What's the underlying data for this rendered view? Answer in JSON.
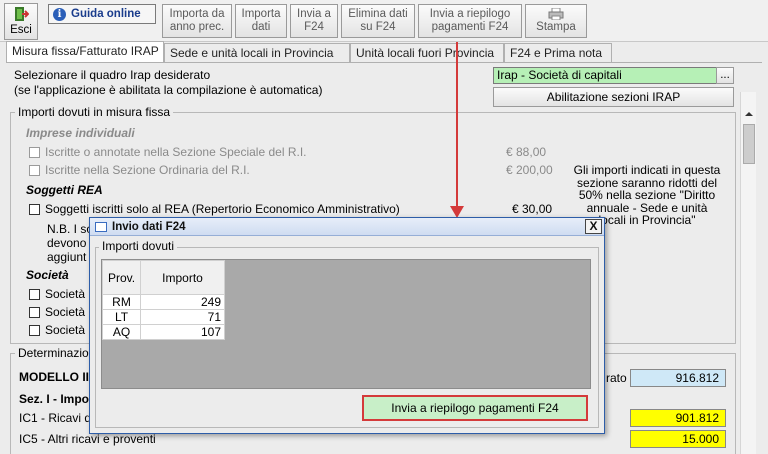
{
  "toolbar": {
    "esci": "Esci",
    "guida": "Guida online",
    "importa_prec": [
      "Importa da",
      "anno prec."
    ],
    "importa_dati": [
      "Importa",
      "dati"
    ],
    "invia_f24": [
      "Invia a",
      "F24"
    ],
    "elimina": [
      "Elimina dati",
      "su F24"
    ],
    "invia_riepilogo": [
      "Invia a riepilogo",
      "pagamenti F24"
    ],
    "stampa": "Stampa"
  },
  "tabs": [
    "Misura fissa/Fatturato IRAP",
    "Sede e unità locali in Provincia",
    "Unità locali fuori Provincia",
    "F24 e Prima nota"
  ],
  "header": {
    "line1": "Selezionare il quadro Irap desiderato",
    "line2": "(se l'applicazione è abilitata la compilazione è automatica)",
    "select_value": "Irap - Società di capitali",
    "select_btn": "...",
    "abilita_btn": "Abilitazione sezioni IRAP"
  },
  "fissa": {
    "title": "Importi dovuti in misura fissa",
    "imprese_ind": "Imprese individuali",
    "iscritte_speciale": "Iscritte o annotate nella Sezione Speciale del R.I.",
    "iscritte_speciale_val": "€ 88,00",
    "iscritte_ordinaria": "Iscritte nella Sezione Ordinaria del R.I.",
    "iscritte_ordinaria_val": "€ 200,00",
    "soggetti_rea": "Soggetti REA",
    "soggetti_iscritti": "Soggetti iscritti solo al REA (Repertorio Economico Amministrativo)",
    "soggetti_iscritti_val": "€ 30,00",
    "nb_1": "N.B. I so",
    "nb_2": "devono",
    "nb_3": "aggiunt",
    "societa": "Società",
    "societa_1": "Società",
    "societa_2": "Società",
    "societa_3": "Società",
    "note": [
      "Gli importi indicati in questa",
      "sezione saranno ridotti del",
      "50% nella sezione \"Diritto",
      "annuale - Sede e unità",
      "locali in Provincia\""
    ]
  },
  "determ": {
    "title": "Determinazio",
    "modello": "MODELLO II",
    "rato": "rato",
    "rato_val": "916.812",
    "sez": "Sez. I - Impo",
    "ic1": "IC1 - Ricavi d",
    "ic1_val": "901.812",
    "ic5": "IC5 - Altri ricavi e proventi",
    "ic5_val": "15.000"
  },
  "dialog": {
    "title": "Invio dati F24",
    "close": "X",
    "group": "Importi dovuti",
    "col_prov": "Prov.",
    "col_importo": "Importo",
    "rows": [
      {
        "prov": "RM",
        "importo": "249"
      },
      {
        "prov": "LT",
        "importo": "71"
      },
      {
        "prov": "AQ",
        "importo": "107"
      }
    ],
    "send_btn": "Invia a riepilogo pagamenti F24"
  },
  "colors": {
    "highlight_red": "#d43a3a",
    "send_btn_green": "#c8efc8",
    "yellow_val": "#ffff00",
    "blue_val": "#cfe8f7",
    "select_green": "#b6f0b6"
  }
}
